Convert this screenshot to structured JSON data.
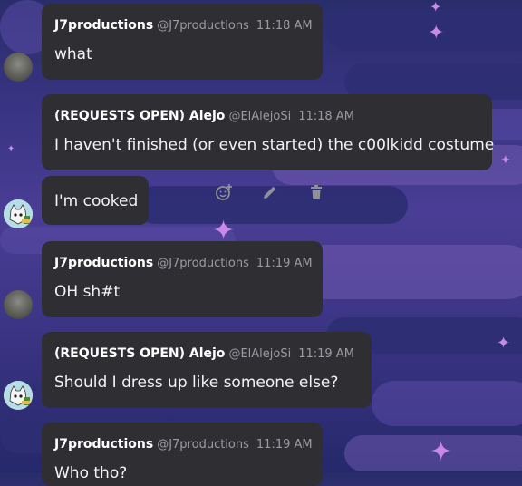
{
  "messages": [
    {
      "author": "J7productions",
      "handle": "@J7productions",
      "time": "11:18 AM",
      "text": "what"
    },
    {
      "author": "(REQUESTS OPEN) Alejo",
      "handle": "@ElAlejoSi",
      "time": "11:18 AM",
      "text": "I haven't finished (or even started) the c00lkidd costume"
    },
    {
      "text": "I'm cooked"
    },
    {
      "author": "J7productions",
      "handle": "@J7productions",
      "time": "11:19 AM",
      "text": "OH sh#t"
    },
    {
      "author": "(REQUESTS OPEN) Alejo",
      "handle": "@ElAlejoSi",
      "time": "11:19 AM",
      "text": "Should I dress up like someone else?"
    },
    {
      "author": "J7productions",
      "handle": "@J7productions",
      "time": "11:19 AM",
      "text": "Who tho?"
    }
  ],
  "actions": [
    {
      "icon": "add-reaction-icon"
    },
    {
      "icon": "edit-pencil-icon"
    },
    {
      "icon": "trash-icon"
    }
  ],
  "colors": {
    "bubble": "#2f2f33",
    "author": "#ffffff",
    "meta": "#9a9ca2",
    "star": "#c889e8"
  }
}
